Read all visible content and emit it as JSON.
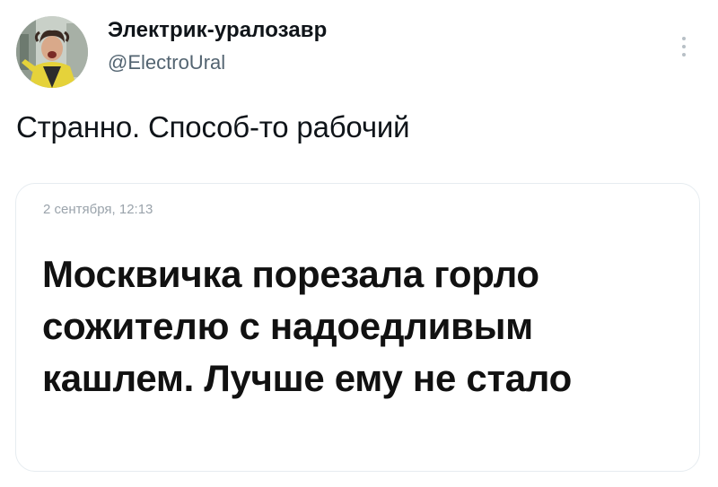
{
  "author": {
    "name": "Электрик-уралозавр",
    "handle": "@ElectroUral"
  },
  "menu": {
    "icon": "more-vertical-icon"
  },
  "tweet": {
    "text": "Странно. Способ-то рабочий"
  },
  "card": {
    "date": "2 сентября, 12:13",
    "headline": "Москвичка порезала горло сожителю с надоедливым кашлем. Лучше ему не стало"
  },
  "colors": {
    "text_primary": "#0f1419",
    "text_secondary": "#536471",
    "card_border": "#e6ecf0",
    "date_gray": "#9aa3ab"
  }
}
